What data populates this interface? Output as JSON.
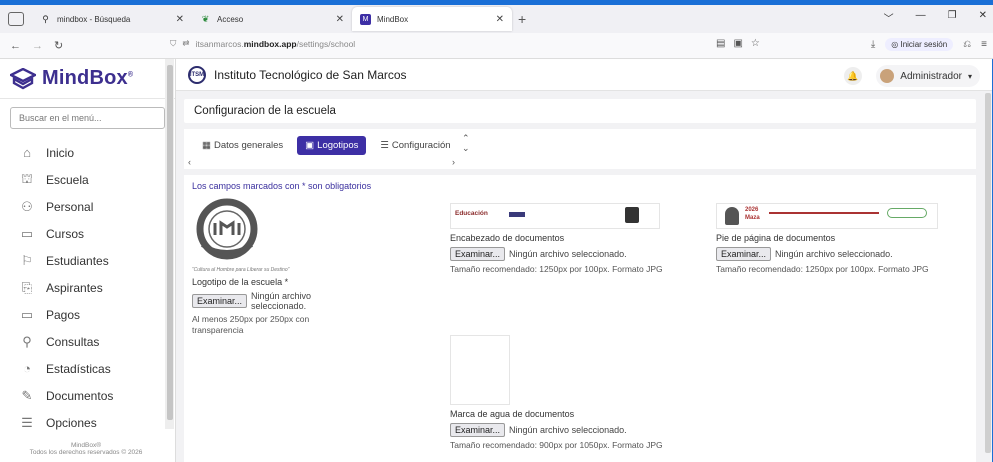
{
  "browser": {
    "tabs": [
      {
        "label": "mindbox - Búsqueda",
        "icon": "search-icon"
      },
      {
        "label": "Acceso",
        "icon": "leaf-icon"
      },
      {
        "label": "MindBox",
        "icon": "mindbox-icon"
      }
    ],
    "url_prefix": "itsanmarcos.",
    "url_domain": "mindbox.app",
    "url_path": "/settings/school",
    "signin_label": "Iniciar sesión"
  },
  "sidebar": {
    "logo_text": "MindBox",
    "logo_reg": "®",
    "search_placeholder": "Buscar en el menú...",
    "items": [
      {
        "label": "Inicio",
        "icon": "home-icon"
      },
      {
        "label": "Escuela",
        "icon": "school-icon"
      },
      {
        "label": "Personal",
        "icon": "users-icon"
      },
      {
        "label": "Cursos",
        "icon": "board-icon"
      },
      {
        "label": "Estudiantes",
        "icon": "graduation-icon"
      },
      {
        "label": "Aspirantes",
        "icon": "applicants-icon"
      },
      {
        "label": "Pagos",
        "icon": "payments-icon"
      },
      {
        "label": "Consultas",
        "icon": "search-icon"
      },
      {
        "label": "Estadísticas",
        "icon": "chart-icon"
      },
      {
        "label": "Documentos",
        "icon": "document-icon"
      },
      {
        "label": "Opciones",
        "icon": "sliders-icon"
      }
    ],
    "footer_brand": "MindBox®",
    "footer_text": "Todos los derechos reservados © 2026"
  },
  "header": {
    "school_name": "Instituto Tecnológico de San Marcos",
    "seal_text": "ITSM",
    "user_name": "Administrador"
  },
  "page": {
    "title": "Configuracion de la escuela",
    "tabs": [
      {
        "label": "Datos generales",
        "active": false
      },
      {
        "label": "Logotipos",
        "active": true
      },
      {
        "label": "Configuración",
        "active": false
      }
    ],
    "required_note": "Los campos marcados con * son obligatorios",
    "file_button": "Examinar...",
    "no_file": "Ningún archivo seleccionado.",
    "fields": {
      "school_logo": {
        "label": "Logotipo de la escuela *",
        "hint": "Al menos 250px por 250px con transparencia",
        "logo_motto": "“Cultura al Hombre para Liberar su Destino”"
      },
      "doc_header": {
        "label": "Encabezado de documentos",
        "hint": "Tamaño recomendado: 1250px por 100px. Formato JPG",
        "preview_text": "Educación"
      },
      "doc_footer": {
        "label": "Pie de página de documentos",
        "hint": "Tamaño recomendado: 1250px por 100px. Formato JPG",
        "preview_year": "2026",
        "preview_name": "Maza"
      },
      "watermark": {
        "label": "Marca de agua de documentos",
        "hint": "Tamaño recomendado: 900px por 1050px. Formato JPG"
      }
    }
  },
  "colors": {
    "accent": "#3d2fa5",
    "browser_frame": "#1a6fd6",
    "brand_text": "#3d2f8f"
  }
}
